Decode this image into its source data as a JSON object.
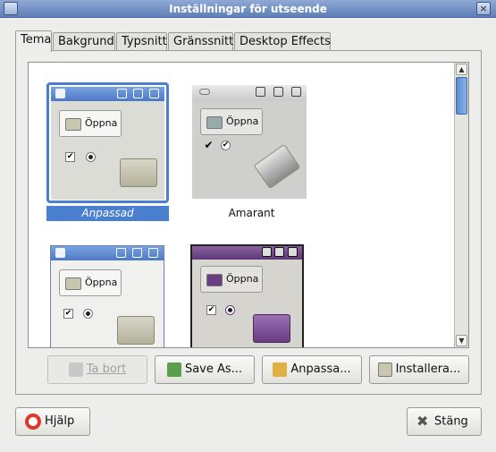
{
  "window": {
    "title": "Inställningar för utseende",
    "close_glyph": "×"
  },
  "tabs": [
    {
      "label": "Tema"
    },
    {
      "label": "Bakgrund"
    },
    {
      "label": "Typsnitt"
    },
    {
      "label": "Gränssnitt"
    },
    {
      "label": "Desktop Effects"
    }
  ],
  "themes": [
    {
      "name": "Anpassad",
      "selected": true,
      "open_label": "Öppna"
    },
    {
      "name": "Amarant",
      "selected": false,
      "open_label": "Öppna"
    },
    {
      "name": "",
      "selected": false,
      "open_label": "Öppna"
    },
    {
      "name": "",
      "selected": false,
      "open_label": "Öppna"
    }
  ],
  "actions": {
    "delete_label": "Ta bort",
    "save_as_label": "Save As...",
    "customize_label": "Anpassa...",
    "install_label": "Installera..."
  },
  "footer": {
    "help_label": "Hjälp",
    "close_label": "Stäng"
  },
  "colors": {
    "selection": "#4a7fcf",
    "accent": "#5f7fb8",
    "purple_theme": "#6a3d80"
  }
}
